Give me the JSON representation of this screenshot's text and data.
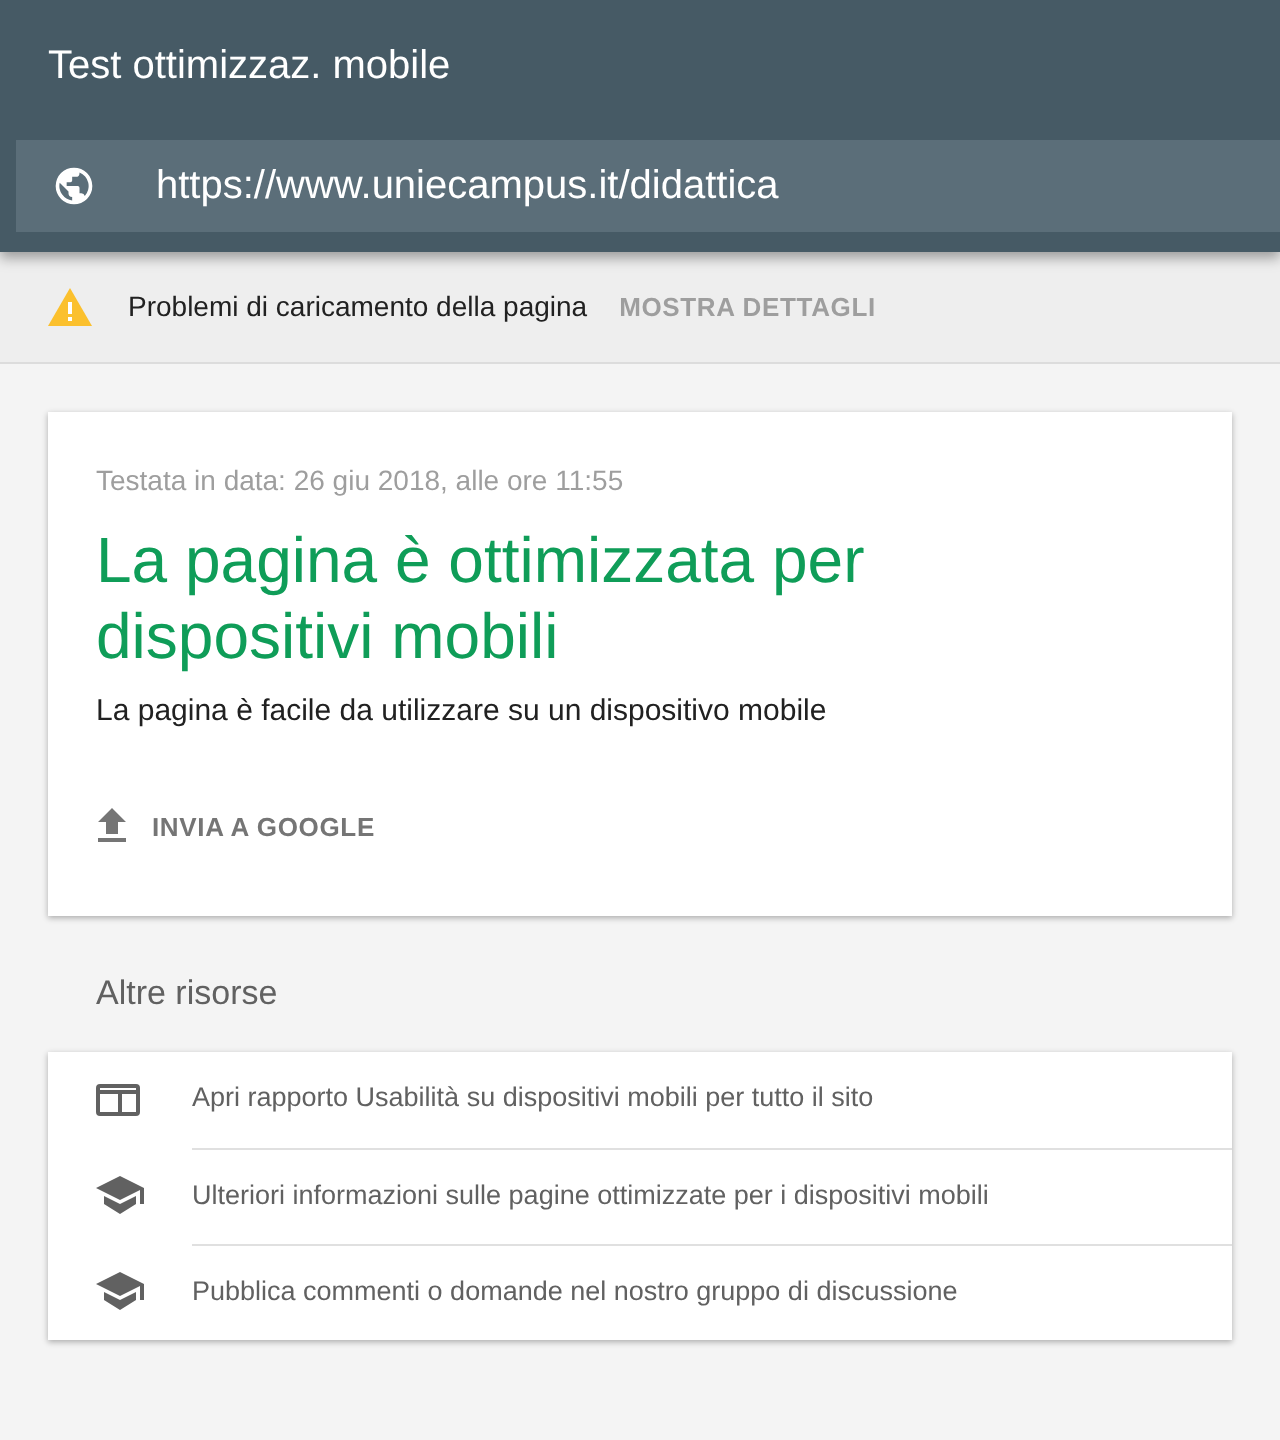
{
  "header": {
    "title": "Test ottimizzaz. mobile",
    "url": "https://www.uniecampus.it/didattica"
  },
  "warning": {
    "text": "Problemi di caricamento della pagina",
    "action": "MOSTRA DETTAGLI"
  },
  "result": {
    "tested": "Testata in data: 26 giu 2018, alle ore 11:55",
    "headline": "La pagina è ottimizzata per dispositivi mobili",
    "description": "La pagina è facile da utilizzare su un dispositivo mobile",
    "action": "INVIA A GOOGLE"
  },
  "resources": {
    "title": "Altre risorse",
    "items": [
      {
        "kind": "report",
        "label": "Apri rapporto Usabilità su dispositivi mobili per tutto il sito"
      },
      {
        "kind": "school",
        "label": "Ulteriori informazioni sulle pagine ottimizzate per i dispositivi mobili"
      },
      {
        "kind": "school",
        "label": "Pubblica commenti o domande nel nostro gruppo di discussione"
      }
    ]
  }
}
